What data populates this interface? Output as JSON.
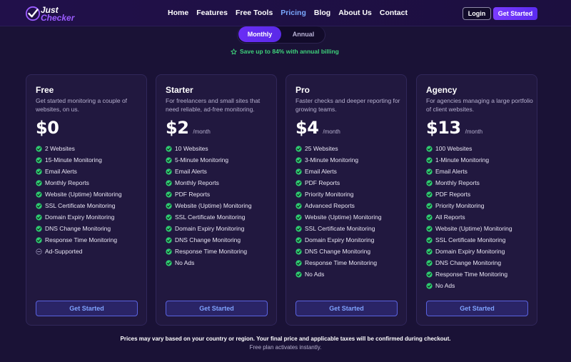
{
  "nav": {
    "logo_line1": "Just",
    "logo_line2": "Checker",
    "links": [
      "Home",
      "Features",
      "Free Tools",
      "Pricing",
      "Blog",
      "About Us",
      "Contact"
    ],
    "active": "Pricing",
    "login": "Login",
    "cta": "Get Started"
  },
  "billing": {
    "monthly": "Monthly",
    "annual": "Annual",
    "selected": "Monthly",
    "save_note": "Save up to 84% with annual billing"
  },
  "plans": [
    {
      "name": "Free",
      "desc": "Get started monitoring a couple of websites, on us.",
      "price": "$0",
      "period": "",
      "features": [
        {
          "text": "2 Websites",
          "included": true
        },
        {
          "text": "15-Minute Monitoring",
          "included": true
        },
        {
          "text": "Email Alerts",
          "included": true
        },
        {
          "text": "Monthly Reports",
          "included": true
        },
        {
          "text": "Website (Uptime) Monitoring",
          "included": true
        },
        {
          "text": "SSL Certificate Monitoring",
          "included": true
        },
        {
          "text": "Domain Expiry Monitoring",
          "included": true
        },
        {
          "text": "DNS Change Monitoring",
          "included": true
        },
        {
          "text": "Response Time Monitoring",
          "included": true
        },
        {
          "text": "Ad-Supported",
          "included": false
        }
      ],
      "cta": "Get Started"
    },
    {
      "name": "Starter",
      "desc": "For freelancers and small sites that need reliable, ad-free monitoring.",
      "price": "$2",
      "period": "/month",
      "features": [
        {
          "text": "10 Websites",
          "included": true
        },
        {
          "text": "5-Minute Monitoring",
          "included": true
        },
        {
          "text": "Email Alerts",
          "included": true
        },
        {
          "text": "Monthly Reports",
          "included": true
        },
        {
          "text": "PDF Reports",
          "included": true
        },
        {
          "text": "Website (Uptime) Monitoring",
          "included": true
        },
        {
          "text": "SSL Certificate Monitoring",
          "included": true
        },
        {
          "text": "Domain Expiry Monitoring",
          "included": true
        },
        {
          "text": "DNS Change Monitoring",
          "included": true
        },
        {
          "text": "Response Time Monitoring",
          "included": true
        },
        {
          "text": "No Ads",
          "included": true
        }
      ],
      "cta": "Get Started"
    },
    {
      "name": "Pro",
      "desc": "Faster checks and deeper reporting for growing teams.",
      "price": "$4",
      "period": "/month",
      "features": [
        {
          "text": "25 Websites",
          "included": true
        },
        {
          "text": "3-Minute Monitoring",
          "included": true
        },
        {
          "text": "Email Alerts",
          "included": true
        },
        {
          "text": "PDF Reports",
          "included": true
        },
        {
          "text": "Priority Monitoring",
          "included": true
        },
        {
          "text": "Advanced Reports",
          "included": true
        },
        {
          "text": "Website (Uptime) Monitoring",
          "included": true
        },
        {
          "text": "SSL Certificate Monitoring",
          "included": true
        },
        {
          "text": "Domain Expiry Monitoring",
          "included": true
        },
        {
          "text": "DNS Change Monitoring",
          "included": true
        },
        {
          "text": "Response Time Monitoring",
          "included": true
        },
        {
          "text": "No Ads",
          "included": true
        }
      ],
      "cta": "Get Started"
    },
    {
      "name": "Agency",
      "desc": "For agencies managing a large portfolio of client websites.",
      "price": "$13",
      "period": "/month",
      "features": [
        {
          "text": "100 Websites",
          "included": true
        },
        {
          "text": "1-Minute Monitoring",
          "included": true
        },
        {
          "text": "Email Alerts",
          "included": true
        },
        {
          "text": "Monthly Reports",
          "included": true
        },
        {
          "text": "PDF Reports",
          "included": true
        },
        {
          "text": "Priority Monitoring",
          "included": true
        },
        {
          "text": "All Reports",
          "included": true
        },
        {
          "text": "Website (Uptime) Monitoring",
          "included": true
        },
        {
          "text": "SSL Certificate Monitoring",
          "included": true
        },
        {
          "text": "Domain Expiry Monitoring",
          "included": true
        },
        {
          "text": "DNS Change Monitoring",
          "included": true
        },
        {
          "text": "Response Time Monitoring",
          "included": true
        },
        {
          "text": "No Ads",
          "included": true
        }
      ],
      "cta": "Get Started"
    }
  ],
  "footer": {
    "note": "Prices may vary based on your country or region. Your final price and applicable taxes will be confirmed during checkout.",
    "free_note": "Free plan activates instantly."
  },
  "colors": {
    "background": "#1a1236",
    "card": "#21183f",
    "accent_purple": "#6a2df5",
    "check_green": "#2ecc71",
    "link_blue": "#7aa9ff"
  },
  "icons": {
    "logo": "checkmark-badge-icon",
    "save": "star-outline-icon",
    "included": "check-circle-icon",
    "excluded": "minus-circle-icon"
  }
}
